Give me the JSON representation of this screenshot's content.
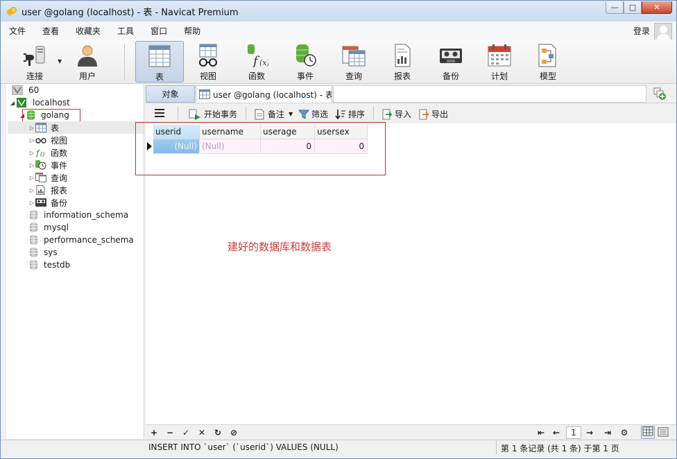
{
  "window": {
    "title": "user @golang (localhost) - 表 - Navicat Premium",
    "controls": {
      "minimize": "—",
      "maximize": "□",
      "close": "✕"
    }
  },
  "menubar": {
    "items": [
      "文件",
      "查看",
      "收藏夹",
      "工具",
      "窗口",
      "帮助"
    ],
    "login_label": "登录"
  },
  "toolbar": {
    "buttons": [
      {
        "label": "连接",
        "icon": "plug-icon"
      },
      {
        "label": "用户",
        "icon": "user-icon"
      },
      {
        "label": "表",
        "icon": "table-icon",
        "active": true
      },
      {
        "label": "视图",
        "icon": "view-glasses-icon"
      },
      {
        "label": "函数",
        "icon": "function-icon"
      },
      {
        "label": "事件",
        "icon": "event-clock-icon"
      },
      {
        "label": "查询",
        "icon": "query-icon"
      },
      {
        "label": "报表",
        "icon": "report-icon"
      },
      {
        "label": "备份",
        "icon": "backup-tape-icon"
      },
      {
        "label": "计划",
        "icon": "calendar-icon"
      },
      {
        "label": "模型",
        "icon": "model-icon"
      }
    ]
  },
  "sidebar": {
    "items": [
      {
        "label": "60",
        "level": 0,
        "icon": "server-icon"
      },
      {
        "label": "localhost",
        "level": 0,
        "icon": "mysql-connection-icon",
        "expanded": true
      },
      {
        "label": "golang",
        "level": 1,
        "icon": "database-icon",
        "expanded": true,
        "highlighted": true
      },
      {
        "label": "表",
        "level": 2,
        "icon": "table-icon",
        "selected": true
      },
      {
        "label": "视图",
        "level": 2,
        "icon": "view-glasses-icon"
      },
      {
        "label": "函数",
        "level": 2,
        "icon": "function-icon"
      },
      {
        "label": "事件",
        "level": 2,
        "icon": "event-clock-icon"
      },
      {
        "label": "查询",
        "level": 2,
        "icon": "query-icon"
      },
      {
        "label": "报表",
        "level": 2,
        "icon": "report-icon"
      },
      {
        "label": "备份",
        "level": 2,
        "icon": "backup-tape-icon"
      },
      {
        "label": "information_schema",
        "level": 1,
        "icon": "database-icon"
      },
      {
        "label": "mysql",
        "level": 1,
        "icon": "database-icon"
      },
      {
        "label": "performance_schema",
        "level": 1,
        "icon": "database-icon"
      },
      {
        "label": "sys",
        "level": 1,
        "icon": "database-icon"
      },
      {
        "label": "testdb",
        "level": 1,
        "icon": "database-icon"
      }
    ]
  },
  "tabs": {
    "objects_label": "对象",
    "active_tab_label": "user @golang (localhost) - 表"
  },
  "subtoolbar": {
    "menu_icon": "hamburger-icon",
    "begin_transaction": "开始事务",
    "comment": "备注",
    "filter": "筛选",
    "sort": "排序",
    "import": "导入",
    "export": "导出"
  },
  "grid": {
    "columns": [
      "userid",
      "username",
      "userage",
      "usersex"
    ],
    "rows": [
      [
        "(Null)",
        "(Null)",
        "0",
        "0"
      ]
    ]
  },
  "annotation_text": "建好的数据库和数据表",
  "navbar": {
    "page_value": "1"
  },
  "statusbar": {
    "sql": "INSERT INTO `user` (`userid`) VALUES (NULL)",
    "record_info": "第 1 条记录 (共 1 条) 于第 1 页"
  },
  "colors": {
    "annotation_red": "#d43a3a",
    "selection_blue": "#8ec2ee",
    "row_pink": "#fdf1fa"
  }
}
